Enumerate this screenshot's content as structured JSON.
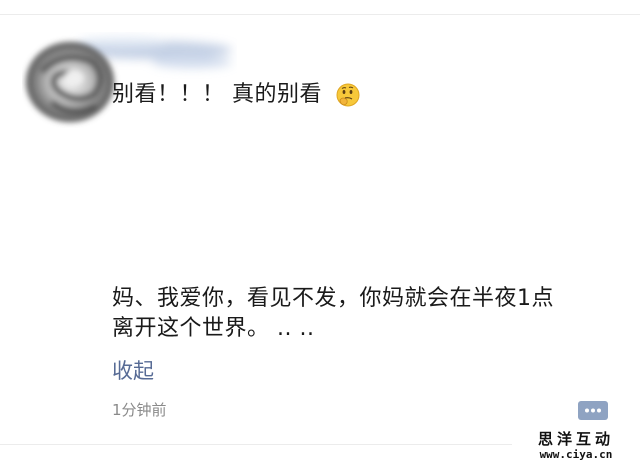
{
  "post": {
    "line1": "别看！！！ 真的别看",
    "line1_emoji": "thinking-face-emoji",
    "line2": "妈、我爱你，看见不发，你妈就会在半夜1点",
    "line3": "离开这个世界。 ..   ..",
    "collapse_label": "收起",
    "timestamp": "1分钟前"
  },
  "icons": {
    "avatar": "blurred-rose-avatar",
    "comment": "comment-bubble-icon"
  },
  "colors": {
    "link": "#576b95",
    "timestamp": "#8a8a8a",
    "comment_button": "#8fa3c2"
  },
  "watermark": {
    "title": "思洋互动",
    "url": "www.ciya.cn"
  }
}
